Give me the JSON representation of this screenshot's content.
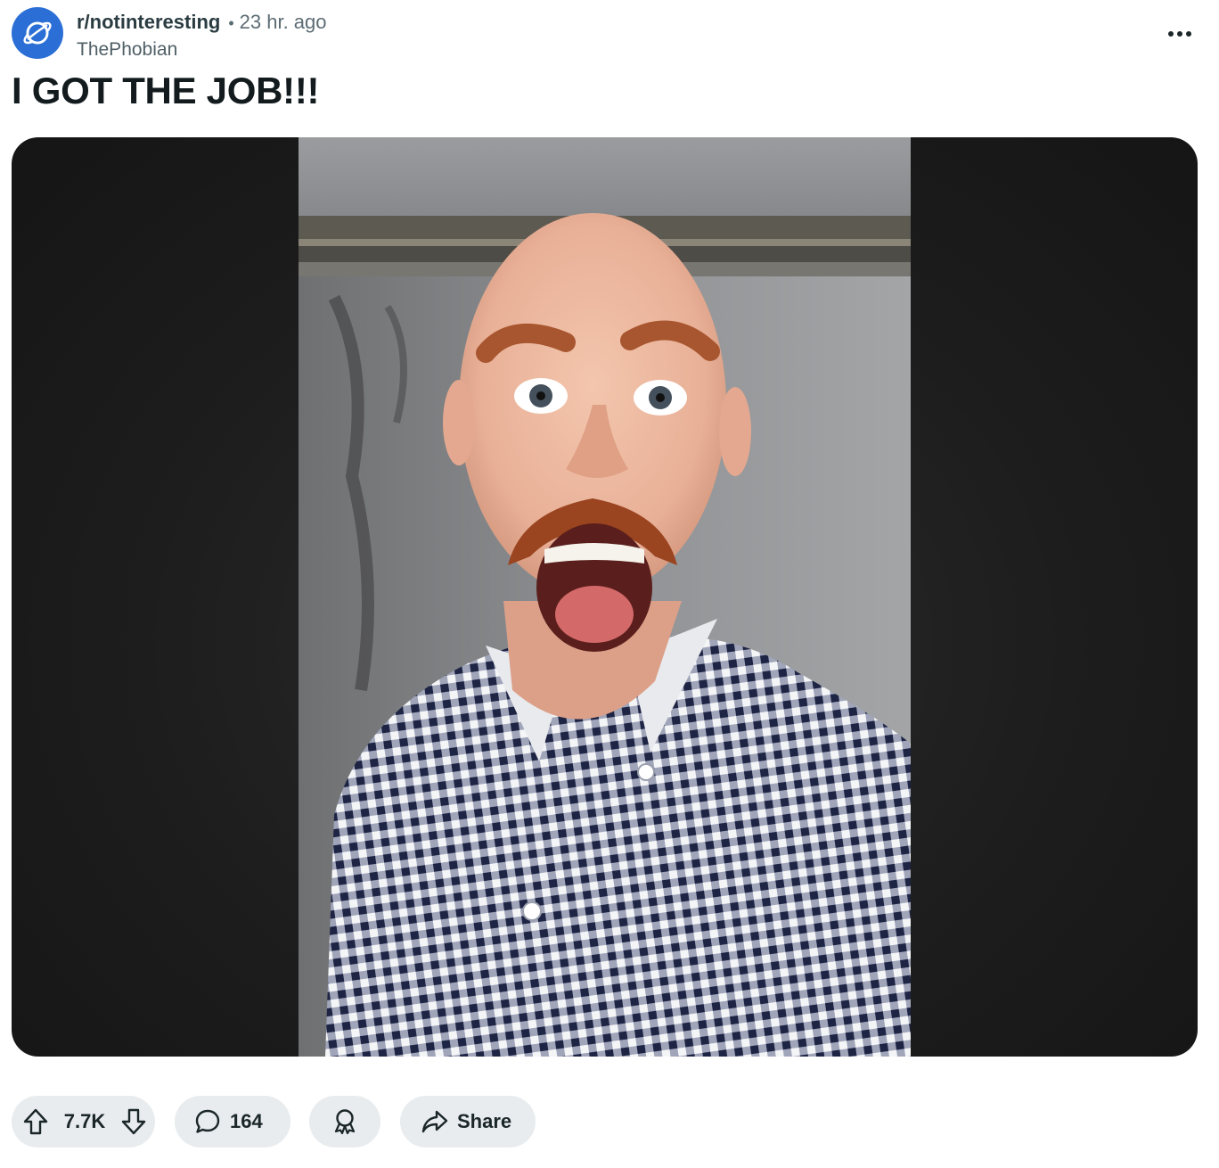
{
  "post": {
    "subreddit": "r/notinteresting",
    "separator": "•",
    "time_ago": "23 hr. ago",
    "author": "ThePhobian",
    "title": "I GOT THE JOB!!!"
  },
  "actions": {
    "score": "7.7K",
    "comments": "164",
    "share_label": "Share"
  },
  "icons": {
    "avatar": "planet-icon",
    "more": "more-horizontal-icon",
    "upvote": "upvote-arrow-icon",
    "downvote": "downvote-arrow-icon",
    "comment": "comment-bubble-icon",
    "award": "award-ribbon-icon",
    "share": "share-arrow-icon"
  },
  "colors": {
    "avatar_bg": "#2b6fd6",
    "pill_bg": "#e8ecee",
    "media_bg": "#1d1d1d"
  }
}
